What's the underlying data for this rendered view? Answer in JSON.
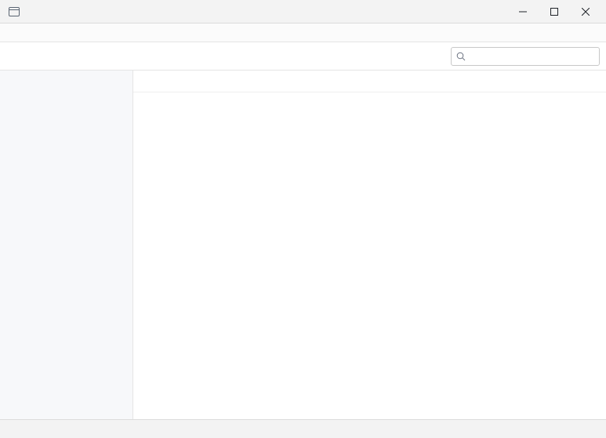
{
  "window": {
    "title": ""
  },
  "menu": {
    "items": []
  },
  "toolbar": {
    "buttons": [],
    "search_placeholder": "",
    "search_value": ""
  },
  "sidebar": {
    "section_title": "",
    "items": []
  },
  "main": {
    "breadcrumb": "",
    "columns": [],
    "rows": []
  },
  "status": {
    "left": "",
    "right": ""
  }
}
